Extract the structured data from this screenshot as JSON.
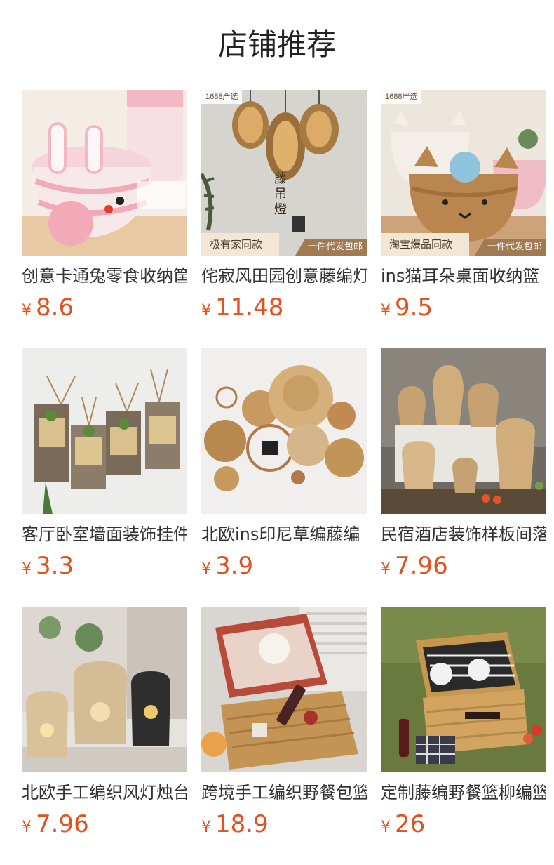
{
  "header": {
    "title": "店铺推荐"
  },
  "currency_symbol": "¥",
  "products": [
    {
      "name": "创意卡通兔零食收纳筐",
      "price": "8.6",
      "icon": "bunny-basket-image"
    },
    {
      "name": "侘寂风田园创意藤编灯",
      "price": "11.48",
      "icon": "rattan-pendant-lamp-image",
      "badge_top": "1688严选",
      "badge_left": "极有家同款",
      "badge_right": "一件代发包邮",
      "overlay_text": "藤 吊 燈"
    },
    {
      "name": "ins猫耳朵桌面收纳篮",
      "price": "9.5",
      "icon": "cat-ear-basket-image",
      "badge_top": "1688严选",
      "badge_left": "淘宝爆品同款",
      "badge_right": "一件代发包邮"
    },
    {
      "name": "客厅卧室墙面装饰挂件",
      "price": "3.3",
      "icon": "wall-hanging-planter-image"
    },
    {
      "name": "北欧ins印尼草编藤编",
      "price": "3.9",
      "icon": "woven-wall-decor-image"
    },
    {
      "name": "民宿酒店装饰样板间落",
      "price": "7.96",
      "icon": "bamboo-lanterns-image"
    },
    {
      "name": "北欧手工编织风灯烛台",
      "price": "7.96",
      "icon": "woven-candle-lantern-image"
    },
    {
      "name": "跨境手工编织野餐包篮",
      "price": "18.9",
      "icon": "picnic-basket-open-image"
    },
    {
      "name": "定制藤编野餐篮柳编篮",
      "price": "26",
      "icon": "wicker-picnic-basket-image"
    }
  ],
  "colors": {
    "price": "#e0521f",
    "title": "#222222",
    "text": "#333333"
  }
}
